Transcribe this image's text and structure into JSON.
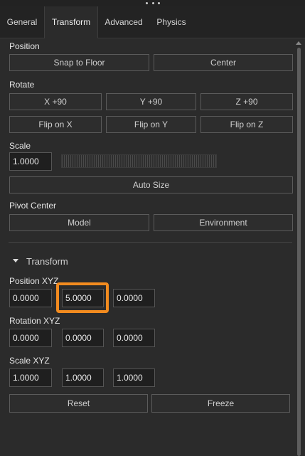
{
  "tabs": [
    {
      "label": "General"
    },
    {
      "label": "Transform"
    },
    {
      "label": "Advanced"
    },
    {
      "label": "Physics"
    }
  ],
  "position": {
    "label": "Position",
    "snap_to_floor": "Snap to Floor",
    "center": "Center"
  },
  "rotate": {
    "label": "Rotate",
    "x90": "X +90",
    "y90": "Y +90",
    "z90": "Z +90",
    "flip_x": "Flip on X",
    "flip_y": "Flip on Y",
    "flip_z": "Flip on Z"
  },
  "scale": {
    "label": "Scale",
    "value": "1.0000",
    "auto_size": "Auto Size"
  },
  "pivot": {
    "label": "Pivot Center",
    "model": "Model",
    "environment": "Environment"
  },
  "transform": {
    "header": "Transform",
    "position_label": "Position XYZ",
    "position": [
      "0.0000",
      "5.0000",
      "0.0000"
    ],
    "rotation_label": "Rotation XYZ",
    "rotation": [
      "0.0000",
      "0.0000",
      "0.0000"
    ],
    "scale_label": "Scale XYZ",
    "scale": [
      "1.0000",
      "1.0000",
      "1.0000"
    ],
    "reset": "Reset",
    "freeze": "Freeze"
  },
  "colors": {
    "background": "#2b2b2b",
    "highlight": "#f28b1f"
  }
}
